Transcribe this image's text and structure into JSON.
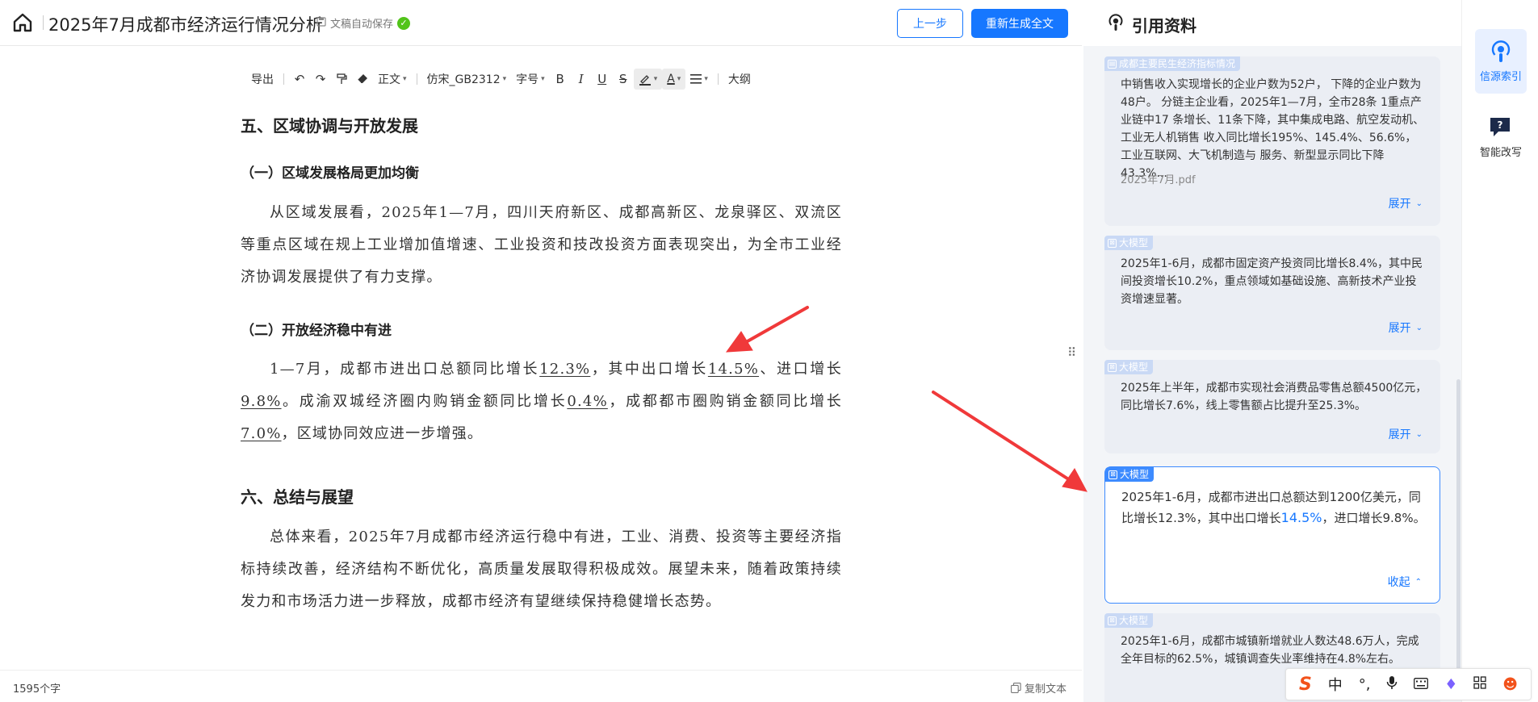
{
  "header": {
    "title": "2025年7月成都市经济运行情况分析",
    "autosave": "文稿自动保存",
    "prev_label": "上一步",
    "regen_label": "重新生成全文"
  },
  "toolbar": {
    "export": "导出",
    "paragraph": "正文",
    "font": "仿宋_GB2312",
    "size": "字号",
    "bold": "B",
    "italic": "I",
    "underline": "U",
    "strike": "S",
    "highlight": "A",
    "outline": "大纲"
  },
  "doc": {
    "sec5_title": "五、区域协调与开放发展",
    "sub1_title": "（一）区域发展格局更加均衡",
    "sub1_text": "从区域发展看，2025年1—7月，四川天府新区、成都高新区、龙泉驿区、双流区等重点区域在规上工业增加值增速、工业投资和技改投资方面表现突出，为全市工业经济协调发展提供了有力支撑。",
    "sub2_title": "（二）开放经济稳中有进",
    "sub2": {
      "t1": "1—7月，成都市进出口总额同比增长",
      "v1": "12.3%",
      "t2": "，其中出口增长",
      "v2": "14.5%",
      "t3": "、进口增长",
      "v3": "9.8%",
      "t4": "。成渝双城经济圈内购销金额同比增长",
      "v4": "0.4%",
      "t5": "，成都都市圈购销金额同比增长",
      "v5": "7.0%",
      "t6": "，区域协同效应进一步增强。"
    },
    "sec6_title": "六、总结与展望",
    "sec6_text": "总体来看，2025年7月成都市经济运行稳中有进，工业、消费、投资等主要经济指标持续改善，经济结构不断优化，高质量发展取得积极成效。展望未来，随着政策持续发力和市场活力进一步释放，成都市经济有望继续保持稳健增长态势。"
  },
  "status": {
    "word_count": "1595个字",
    "copy_text": "复制文本"
  },
  "panel": {
    "title": "引用资料",
    "cards": [
      {
        "tag": "成都主要民生经济指标情况",
        "text": "中销售收入实现增长的企业户数为52户， 下降的企业户数为48户。 分链主企业看，2025年1—7月，全市28条 1重点产业链中17 条增长、11条下降，其中集成电路、航空发动机、工业无人机销售 收入同比增长195%、145.4%、56.6%，工业互联网、大飞机制造与 服务、新型显示同比下降43.3%...",
        "source": "2025年7月.pdf",
        "toggle": "展开"
      },
      {
        "tag": "大模型",
        "text": "2025年1-6月，成都市固定资产投资同比增长8.4%，其中民间投资增长10.2%，重点领域如基础设施、高新技术产业投资增速显著。",
        "toggle": "展开"
      },
      {
        "tag": "大模型",
        "text": "2025年上半年，成都市实现社会消费品零售总额4500亿元，同比增长7.6%，线上零售额占比提升至25.3%。",
        "toggle": "展开"
      },
      {
        "tag": "大模型",
        "text_a": "2025年1-6月，成都市进出口总额达到1200亿美元，同比增长12.3%，其中出口增长",
        "text_hl": "14.5%",
        "text_b": "，进口增长9.8%。",
        "toggle": "收起"
      },
      {
        "tag": "大模型",
        "text": "2025年1-6月，成都市城镇新增就业人数达48.6万人，完成全年目标的62.5%，城镇调查失业率维持在4.8%左右。"
      }
    ]
  },
  "rail": {
    "source_index": "信源索引",
    "smart_rewrite": "智能改写"
  },
  "ime": {
    "lang": "中"
  },
  "colors": {
    "accent": "#1677ff",
    "arrow": "#f0393a",
    "ok": "#52c41a"
  }
}
